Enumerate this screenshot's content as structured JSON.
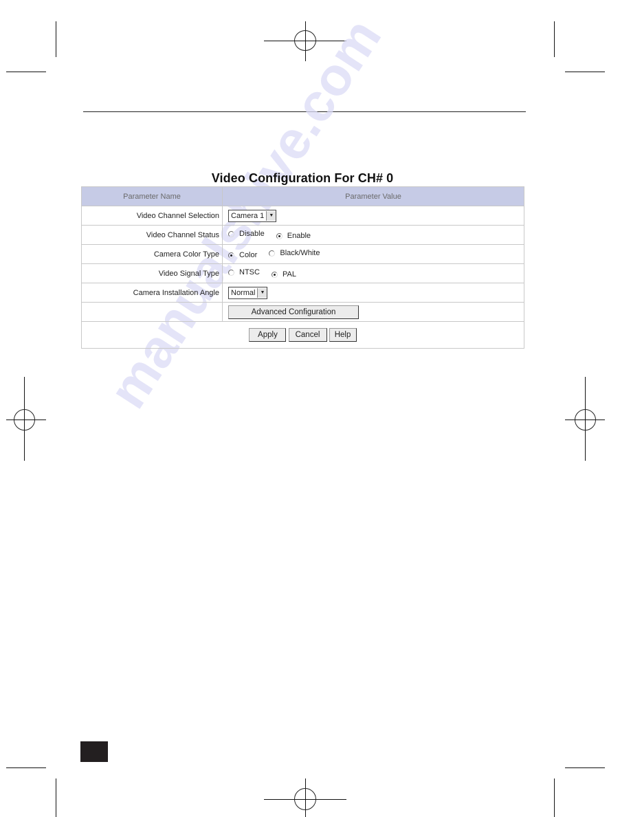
{
  "panel": {
    "title": "Video Configuration For CH# 0",
    "headers": {
      "name": "Parameter Name",
      "value": "Parameter Value"
    },
    "rows": [
      {
        "label": "Video Channel Selection",
        "type": "select",
        "value": "Camera 1"
      },
      {
        "label": "Video Channel Status",
        "type": "radio",
        "options": [
          "Disable",
          "Enable"
        ],
        "selected": "Enable"
      },
      {
        "label": "Camera Color Type",
        "type": "radio",
        "options": [
          "Color",
          "Black/White"
        ],
        "selected": "Color"
      },
      {
        "label": "Video Signal Type",
        "type": "radio",
        "options": [
          "NTSC",
          "PAL"
        ],
        "selected": "PAL"
      },
      {
        "label": "Camera Installation Angle",
        "type": "select",
        "value": "Normal"
      }
    ],
    "advanced_button": "Advanced Configuration",
    "buttons": {
      "apply": "Apply",
      "cancel": "Cancel",
      "help": "Help"
    }
  },
  "watermark": "manualshive.com",
  "icons": {
    "dropdown": "chevron-down-icon",
    "radio": "radio-icon",
    "registration": "crosshair-registration-icon"
  }
}
